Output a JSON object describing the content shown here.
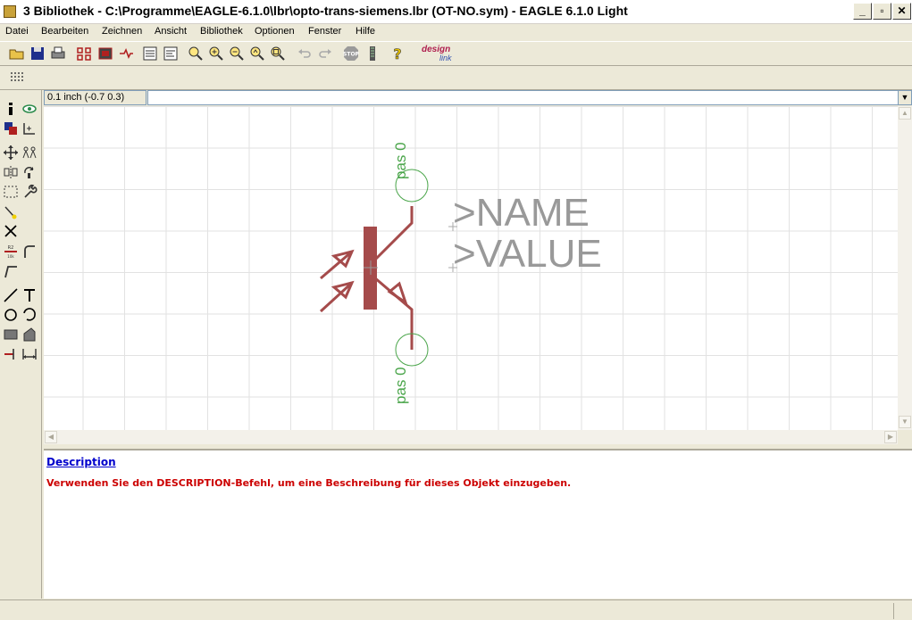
{
  "window": {
    "title": "3 Bibliothek - C:\\Programme\\EAGLE-6.1.0\\lbr\\opto-trans-siemens.lbr (OT-NO.sym) - EAGLE 6.1.0 Light",
    "min_glyph": "_",
    "max_glyph": "▫",
    "close_glyph": "✕"
  },
  "menu": {
    "items": [
      "Datei",
      "Bearbeiten",
      "Zeichnen",
      "Ansicht",
      "Bibliothek",
      "Optionen",
      "Fenster",
      "Hilfe"
    ]
  },
  "toolbar": {
    "brand_line1": "design",
    "brand_line2": "link",
    "stop_label": "STOP",
    "help_label": "?"
  },
  "command": {
    "coord": "0.1 inch (-0.7 0.3)",
    "input_value": ""
  },
  "symbol": {
    "name_placeholder": ">NAME",
    "value_placeholder": ">VALUE",
    "pin_top_label": "pas 0",
    "pin_bottom_label": "pas 0"
  },
  "description": {
    "heading": "Description",
    "message": "Verwenden Sie den DESCRIPTION-Befehl, um eine Beschreibung für dieses Objekt einzugeben."
  },
  "colors": {
    "symbol_body": "#a54b4b",
    "pin_green": "#4aa54a",
    "placeholder_gray": "#999999",
    "link_blue": "#0000cc",
    "error_red": "#cc0000"
  }
}
